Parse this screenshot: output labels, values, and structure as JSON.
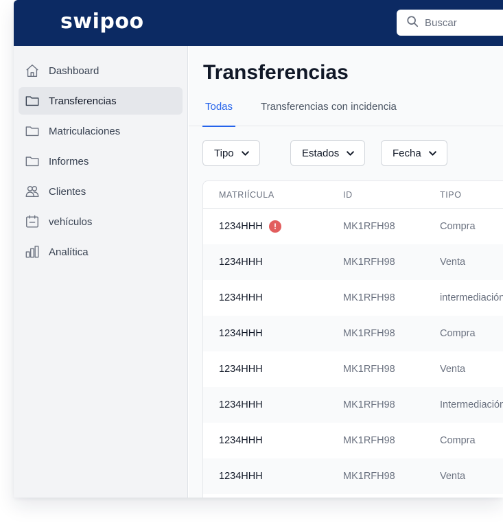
{
  "brand": {
    "logo_text": "swipoo",
    "header_color": "#0c2a63",
    "accent_color": "#2563eb",
    "alert_color": "#e25d5d"
  },
  "search": {
    "placeholder": "Buscar",
    "icon": "search-icon"
  },
  "sidebar": {
    "items": [
      {
        "label": "Dashboard",
        "icon": "home-icon"
      },
      {
        "label": "Transferencias",
        "icon": "folder-icon",
        "active": true
      },
      {
        "label": "Matriculaciones",
        "icon": "folder-icon"
      },
      {
        "label": "Informes",
        "icon": "folder-icon"
      },
      {
        "label": "Clientes",
        "icon": "users-icon"
      },
      {
        "label": "vehículos",
        "icon": "calendar-icon"
      },
      {
        "label": "Analítica",
        "icon": "bar-chart-icon"
      }
    ]
  },
  "main": {
    "title": "Transferencias",
    "tabs": [
      {
        "label": "Todas",
        "active": true
      },
      {
        "label": "Transferencias con incidencia"
      }
    ],
    "filters": [
      {
        "label": "Tipo"
      },
      {
        "label": "Estados"
      },
      {
        "label": "Fecha"
      }
    ],
    "table": {
      "columns": [
        "MATRIÍCULA",
        "ID",
        "TIPO"
      ],
      "rows": [
        {
          "matricula": "1234HHH",
          "id": "MK1RFH98",
          "tipo": "Compra",
          "alert": "!"
        },
        {
          "matricula": "1234HHH",
          "id": "MK1RFH98",
          "tipo": "Venta"
        },
        {
          "matricula": "1234HHH",
          "id": "MK1RFH98",
          "tipo": "intermediación"
        },
        {
          "matricula": "1234HHH",
          "id": "MK1RFH98",
          "tipo": "Compra"
        },
        {
          "matricula": "1234HHH",
          "id": "MK1RFH98",
          "tipo": "Venta"
        },
        {
          "matricula": "1234HHH",
          "id": "MK1RFH98",
          "tipo": "Intermediación"
        },
        {
          "matricula": "1234HHH",
          "id": "MK1RFH98",
          "tipo": "Compra"
        },
        {
          "matricula": "1234HHH",
          "id": "MK1RFH98",
          "tipo": "Venta"
        }
      ]
    }
  }
}
